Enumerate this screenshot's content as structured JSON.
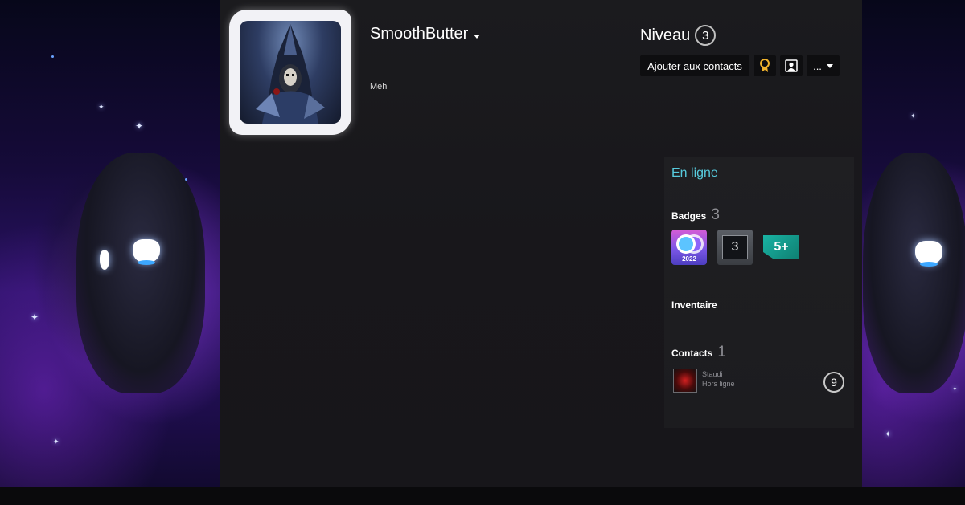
{
  "profile": {
    "persona_name": "SmoothButter",
    "summary": "Meh",
    "level_label": "Niveau",
    "level_value": "3"
  },
  "actions": {
    "add_friend_label": "Ajouter aux contacts",
    "award_icon": "award-icon",
    "profile_icon": "profile-icon",
    "more_label": "..."
  },
  "sidebar": {
    "online_status": "En ligne",
    "badges": {
      "title": "Badges",
      "count": "3",
      "items": [
        {
          "icon": "steam-2022-badge",
          "text": "2022"
        },
        {
          "icon": "years-service-badge",
          "text": "3"
        },
        {
          "icon": "game-collector-badge",
          "text": "5+"
        }
      ]
    },
    "inventory": {
      "title": "Inventaire"
    },
    "contacts": {
      "title": "Contacts",
      "count": "1",
      "items": [
        {
          "name": "Staudi",
          "status": "Hors ligne"
        }
      ],
      "badge_number": "9"
    }
  },
  "colors": {
    "online": "#57cbde",
    "panel": "#1b1b1e",
    "button": "#0e0e10"
  }
}
